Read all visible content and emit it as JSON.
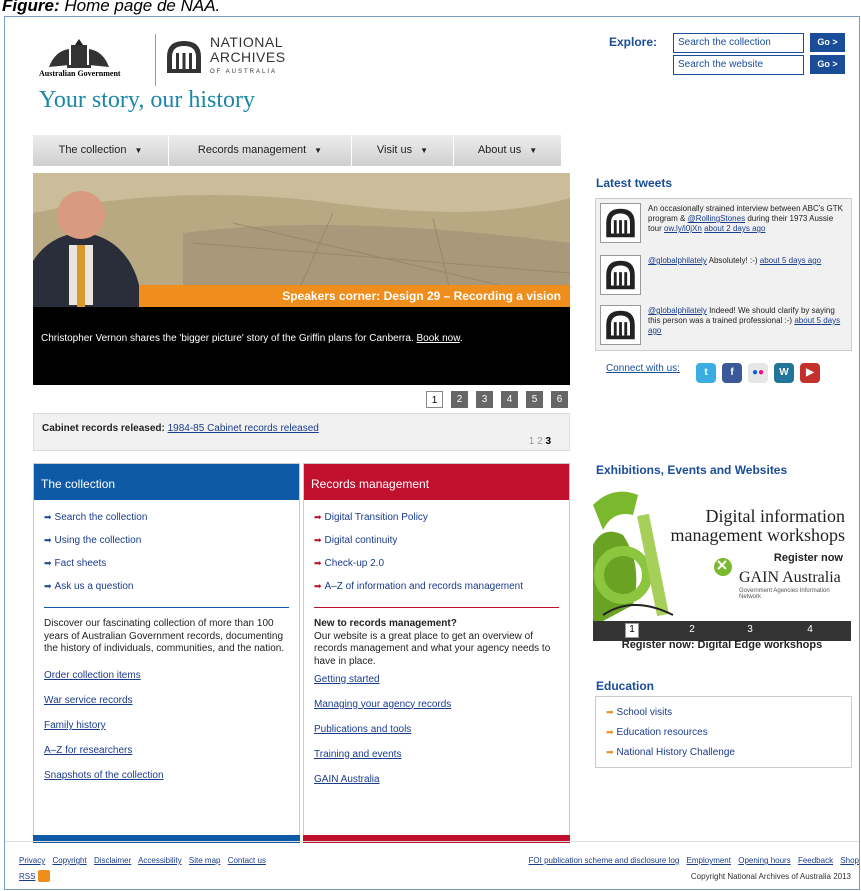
{
  "caption": {
    "prefix": "Figure",
    "text": "Home page de NAA."
  },
  "header": {
    "gov_label": "Australian Government",
    "naa_line1": "NATIONAL",
    "naa_line2": "ARCHIVES",
    "naa_line3": "OF AUSTRALIA",
    "tagline": "Your story, our history"
  },
  "search": {
    "label": "Explore:",
    "collection_placeholder": "Search the collection",
    "website_placeholder": "Search the website",
    "go_label": "Go >"
  },
  "nav": [
    {
      "label": "The collection"
    },
    {
      "label": "Records management"
    },
    {
      "label": "Visit us"
    },
    {
      "label": "About us"
    }
  ],
  "hero": {
    "title": "Speakers corner: Design 29 – Recording a vision",
    "caption": "Christopher Vernon shares the 'bigger picture' story of the Griffin plans for Canberra.",
    "caption_link": "Book now",
    "pages": [
      "1",
      "2",
      "3",
      "4",
      "5",
      "6"
    ],
    "current_page": "1"
  },
  "cabinet": {
    "label": "Cabinet records released:",
    "link": "1984-85 Cabinet records released",
    "pages": [
      "1",
      "2",
      "3"
    ],
    "current": "3"
  },
  "collection": {
    "heading": "The collection",
    "links": [
      "Search the collection",
      "Using the collection",
      "Fact sheets",
      "Ask us a question"
    ],
    "description": "Discover our fascinating collection of more than 100 years of Australian Government records, documenting the history of individuals, communities, and the nation.",
    "more_links": [
      "Order collection items",
      "War service records",
      "Family history",
      "A–Z for researchers",
      "Snapshots of the collection"
    ],
    "color": "#0e5aa7"
  },
  "records": {
    "heading": "Records management",
    "links": [
      "Digital Transition Policy",
      "Digital continuity",
      "Check-up 2.0",
      "A–Z of information and records management"
    ],
    "subheading": "New to records management?",
    "description": "Our website is a great place to get an overview of records management and what your agency needs to have in place.",
    "more_links": [
      "Getting started",
      "Managing your agency records",
      "Publications and tools",
      "Training and events",
      "GAIN Australia"
    ],
    "color": "#c0102e"
  },
  "tweets": {
    "title": "Latest tweets",
    "items": [
      {
        "text": "An occasionally strained interview between ABC's GTK program &",
        "mention": "@RollingStones",
        "text2": "during their 1973 Aussie tour",
        "link": "ow.ly/i0jXn",
        "time": "about 2 days ago"
      },
      {
        "mention": "@globalphilately",
        "text2": "Absolutely! :-)",
        "time": "about 5 days ago"
      },
      {
        "mention": "@globalphilately",
        "text2": "Indeed! We should clarify by saying this person was a trained professional :-)",
        "time": "about 5 days ago"
      }
    ],
    "connect_label": "Connect with us:",
    "social_icons": [
      "twitter-icon",
      "facebook-icon",
      "flickr-icon",
      "wordpress-icon",
      "youtube-icon"
    ]
  },
  "exhibitions": {
    "title": "Exhibitions, Events and Websites",
    "banner_line1": "Digital information",
    "banner_line2": "management workshops",
    "banner_cta": "Register now",
    "banner_brand": "GAIN Australia",
    "banner_brand_sub": "Government Agencies Information Network",
    "pages": [
      "1",
      "2",
      "3",
      "4"
    ],
    "current_page": "1",
    "caption": "Register now: Digital Edge workshops"
  },
  "education": {
    "title": "Education",
    "links": [
      "School visits",
      "Education resources",
      "National History Challenge"
    ]
  },
  "footer": {
    "left_links": [
      "Privacy",
      "Copyright",
      "Disclaimer",
      "Accessibility",
      "Site map",
      "Contact us"
    ],
    "right_links": [
      "FOI publication scheme and disclosure log",
      "Employment",
      "Opening hours",
      "Feedback",
      "Shop"
    ],
    "rss": "RSS",
    "copyright": "Copyright National Archives of Australia 2013"
  }
}
